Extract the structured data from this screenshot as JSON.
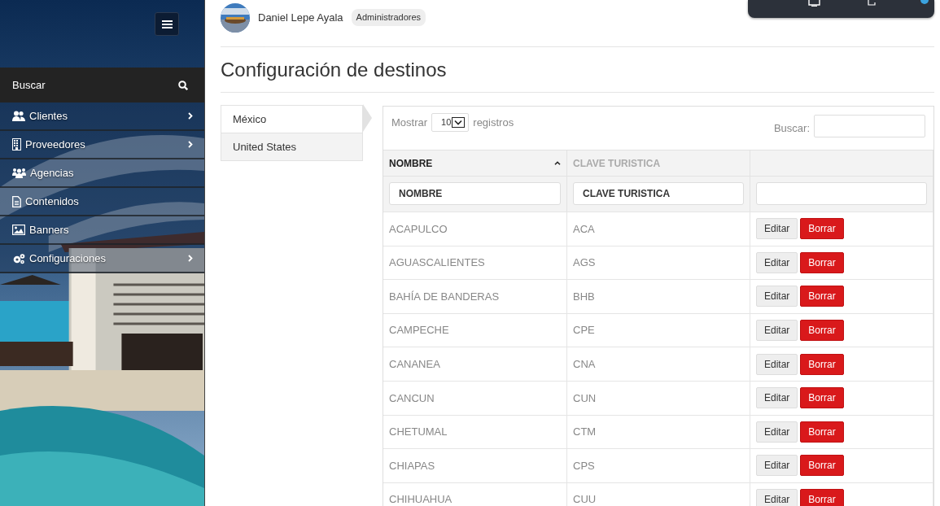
{
  "sidebar": {
    "search_label": "Buscar",
    "items": [
      {
        "label": "Clientes",
        "expandable": true
      },
      {
        "label": "Proveedores",
        "expandable": true
      },
      {
        "label": "Agencias",
        "expandable": false
      },
      {
        "label": "Contenidos",
        "expandable": false
      },
      {
        "label": "Banners",
        "expandable": false
      },
      {
        "label": "Configuraciones",
        "expandable": true
      }
    ]
  },
  "user": {
    "name": "Daniel Lepe Ayala",
    "role": "Administradores"
  },
  "page_title": "Configuración de destinos",
  "tabs": [
    {
      "label": "México",
      "selected": true
    },
    {
      "label": "United States",
      "selected": false
    }
  ],
  "table": {
    "show_label": "Mostrar",
    "page_size": "10",
    "records_label": "registros",
    "search_label": "Buscar:",
    "columns": [
      {
        "label": "NOMBRE",
        "sorted": true
      },
      {
        "label": "CLAVE TURISTICA",
        "sorted": false
      },
      {
        "sorted": false
      }
    ],
    "filters": [
      {
        "placeholder": "NOMBRE"
      },
      {
        "placeholder": "CLAVE TURISTICA"
      }
    ],
    "rows": [
      {
        "name": "ACAPULCO",
        "code": "ACA",
        "edit": "Editar",
        "delete": "Borrar"
      },
      {
        "name": "AGUASCALIENTES",
        "code": "AGS",
        "edit": "Editar",
        "delete": "Borrar"
      },
      {
        "name": "BAHÍA DE BANDERAS",
        "code": "BHB",
        "edit": "Editar",
        "delete": "Borrar"
      },
      {
        "name": "CAMPECHE",
        "code": "CPE",
        "edit": "Editar",
        "delete": "Borrar"
      },
      {
        "name": "CANANEA",
        "code": "CNA",
        "edit": "Editar",
        "delete": "Borrar"
      },
      {
        "name": "CANCUN",
        "code": "CUN",
        "edit": "Editar",
        "delete": "Borrar"
      },
      {
        "name": "CHETUMAL",
        "code": "CTM",
        "edit": "Editar",
        "delete": "Borrar"
      },
      {
        "name": "CHIAPAS",
        "code": "CPS",
        "edit": "Editar",
        "delete": "Borrar"
      },
      {
        "name": "CHIHUAHUA",
        "code": "CUU",
        "edit": "Editar",
        "delete": "Borrar"
      }
    ]
  }
}
